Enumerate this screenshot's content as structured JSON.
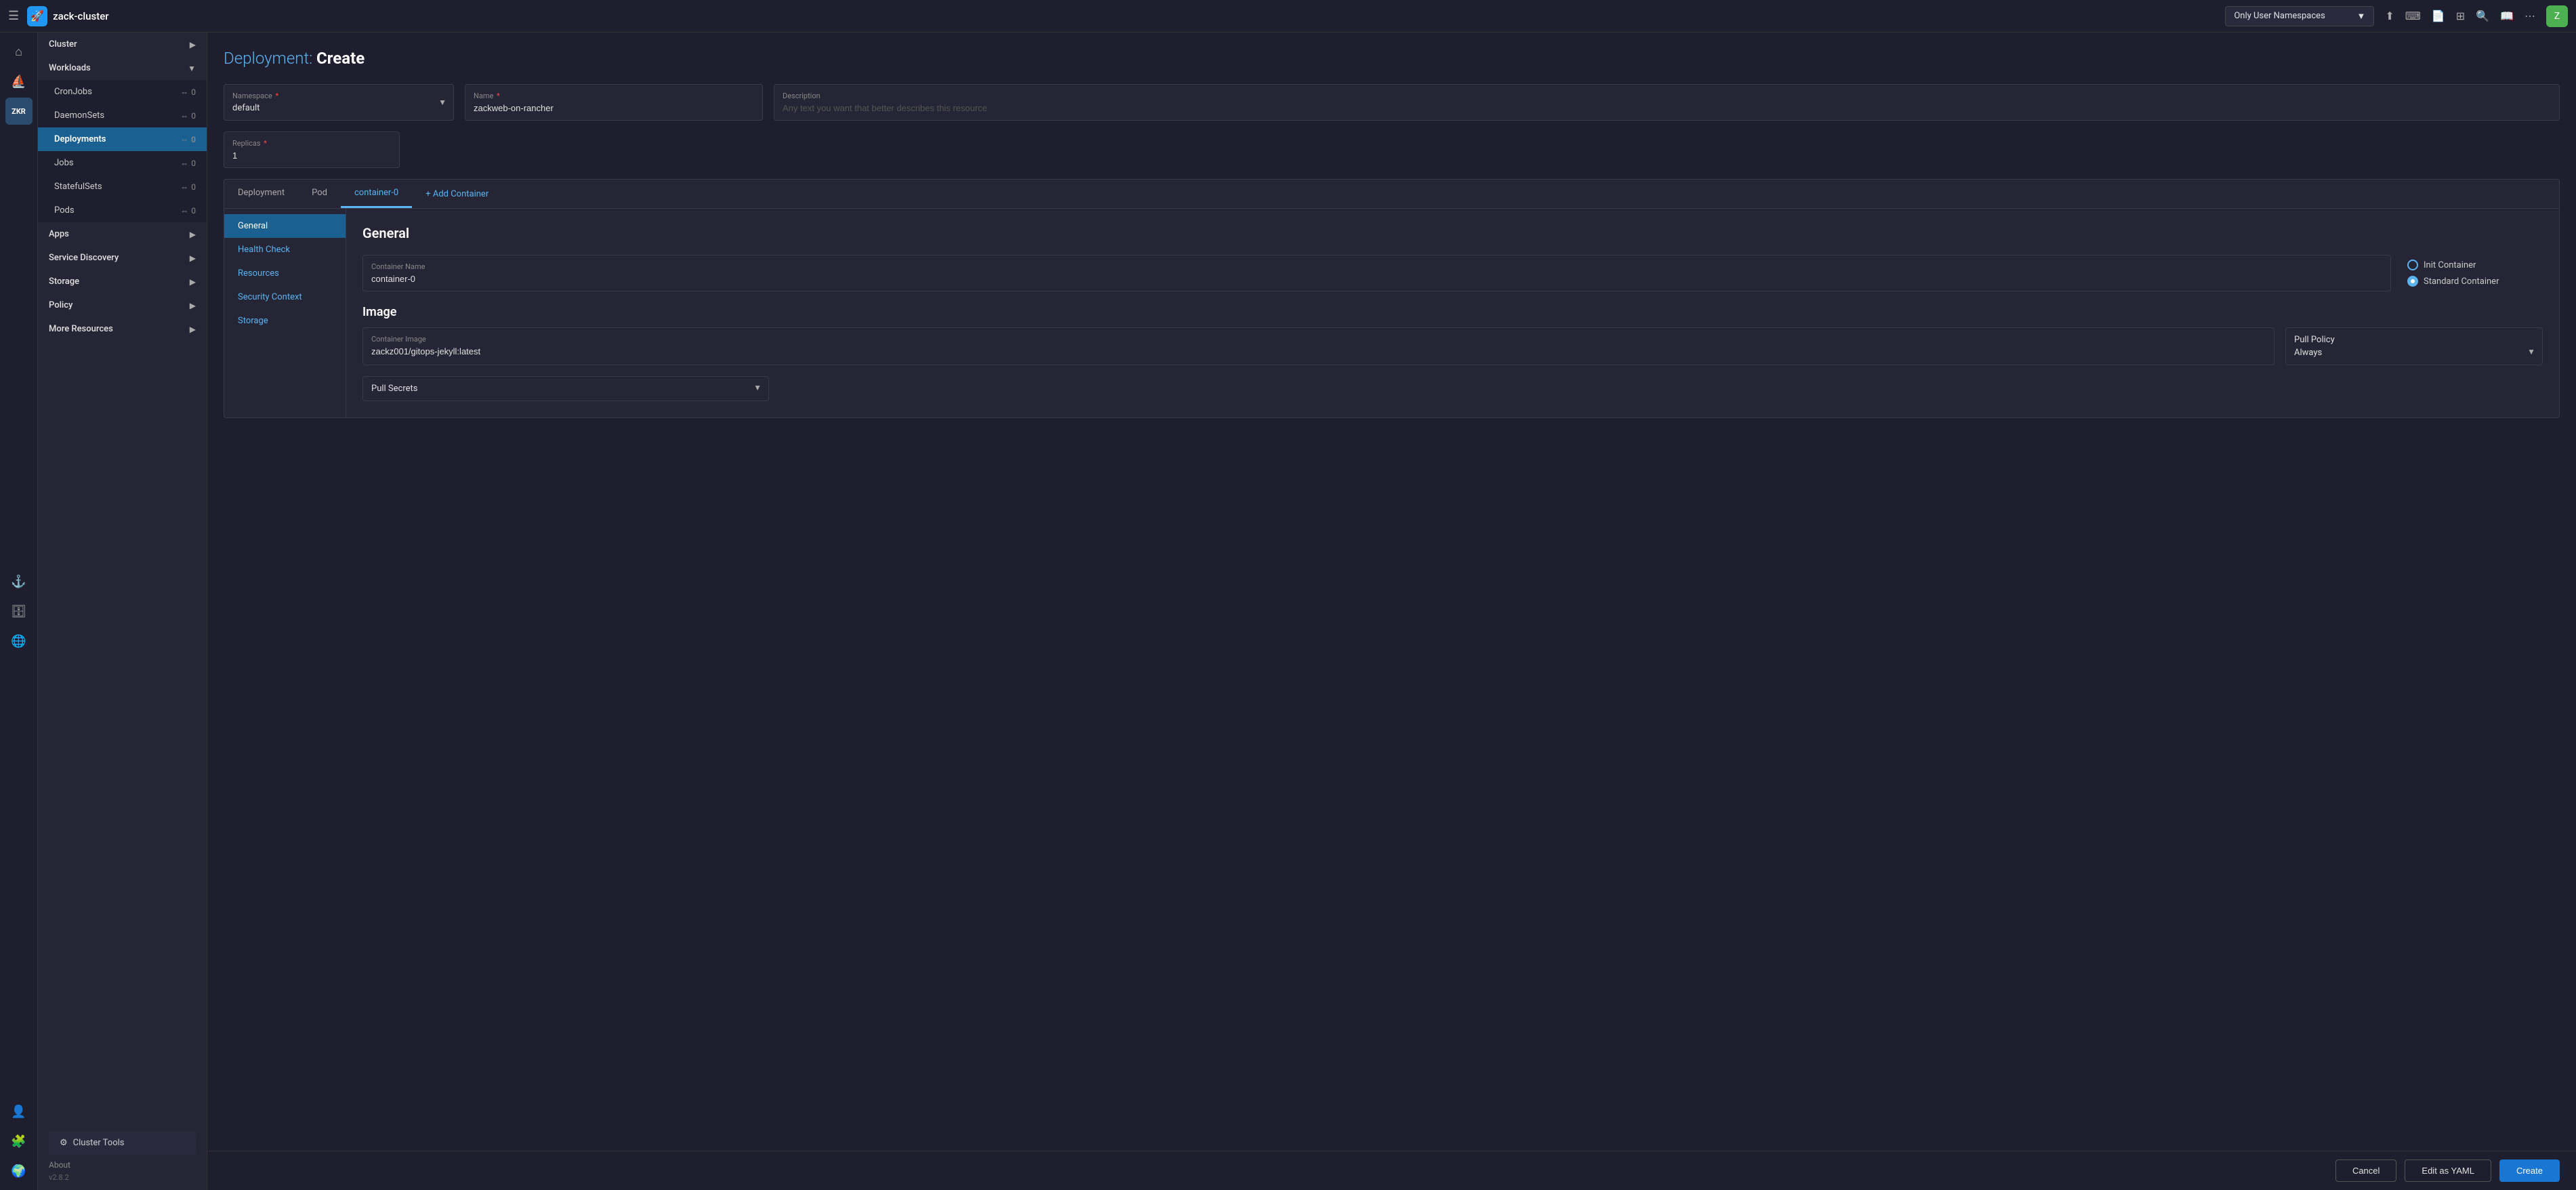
{
  "header": {
    "hamburger_label": "☰",
    "brand_name": "zack-cluster",
    "brand_logo_text": "🚀",
    "namespace_selector": {
      "value": "Only User Namespaces",
      "arrow": "▼"
    },
    "icons": {
      "upload": "⬆",
      "terminal": "⌨",
      "file": "📄",
      "grid": "⊞",
      "search": "🔍",
      "book": "📖",
      "dots": "⋯"
    },
    "avatar_text": "Z"
  },
  "icon_sidebar": {
    "home_icon": "⌂",
    "ship_icon": "⛵",
    "zkr_label": "ZKR",
    "anchor_icon": "⚓",
    "storage_icon": "🗄",
    "globe_icon": "🌐",
    "user_icon": "👤",
    "puzzle_icon": "🧩",
    "world_icon": "🌍",
    "about_label": "About"
  },
  "nav_sidebar": {
    "cluster_label": "Cluster",
    "cluster_arrow": "▶",
    "workloads_label": "Workloads",
    "workloads_arrow": "▼",
    "items": [
      {
        "label": "CronJobs",
        "count": "0"
      },
      {
        "label": "DaemonSets",
        "count": "0"
      },
      {
        "label": "Deployments",
        "count": "0",
        "active": true
      },
      {
        "label": "Jobs",
        "count": "0"
      },
      {
        "label": "StatefulSets",
        "count": "0"
      },
      {
        "label": "Pods",
        "count": "0"
      }
    ],
    "apps_label": "Apps",
    "apps_arrow": "▶",
    "service_discovery_label": "Service Discovery",
    "service_discovery_arrow": "▶",
    "storage_label": "Storage",
    "storage_arrow": "▶",
    "policy_label": "Policy",
    "policy_arrow": "▶",
    "more_resources_label": "More Resources",
    "more_resources_arrow": "▶",
    "cluster_tools_label": "Cluster Tools",
    "cluster_tools_icon": "⚙",
    "about_label": "About",
    "version_label": "v2.8.2"
  },
  "page": {
    "title_prefix": "Deployment: ",
    "title_action": "Create"
  },
  "form": {
    "namespace_label": "Namespace",
    "namespace_required": "*",
    "namespace_value": "default",
    "name_label": "Name",
    "name_required": "*",
    "name_value": "zackweb-on-rancher",
    "description_label": "Description",
    "description_placeholder": "Any text you want that better describes this resource",
    "replicas_label": "Replicas",
    "replicas_required": "*",
    "replicas_value": "1"
  },
  "tabs": [
    {
      "label": "Deployment",
      "active": false
    },
    {
      "label": "Pod",
      "active": false
    },
    {
      "label": "container-0",
      "active": true
    }
  ],
  "add_container_label": "+ Add Container",
  "container_nav": [
    {
      "label": "General",
      "active": true
    },
    {
      "label": "Health Check",
      "active": false
    },
    {
      "label": "Resources",
      "active": false
    },
    {
      "label": "Security Context",
      "active": false
    },
    {
      "label": "Storage",
      "active": false
    }
  ],
  "container_form": {
    "general_title": "General",
    "container_name_label": "Container Name",
    "container_name_value": "container-0",
    "init_container_label": "Init Container",
    "standard_container_label": "Standard Container",
    "image_title": "Image",
    "container_image_label": "Container Image",
    "container_image_value": "zackz001/gitops-jekyll:latest",
    "pull_policy_label": "Pull Policy",
    "pull_policy_value": "Always",
    "pull_policy_arrow": "▼",
    "pull_secrets_label": "Pull Secrets",
    "pull_secrets_arrow": "▼"
  },
  "bottom_bar": {
    "cancel_label": "Cancel",
    "edit_yaml_label": "Edit as YAML",
    "create_label": "Create"
  }
}
